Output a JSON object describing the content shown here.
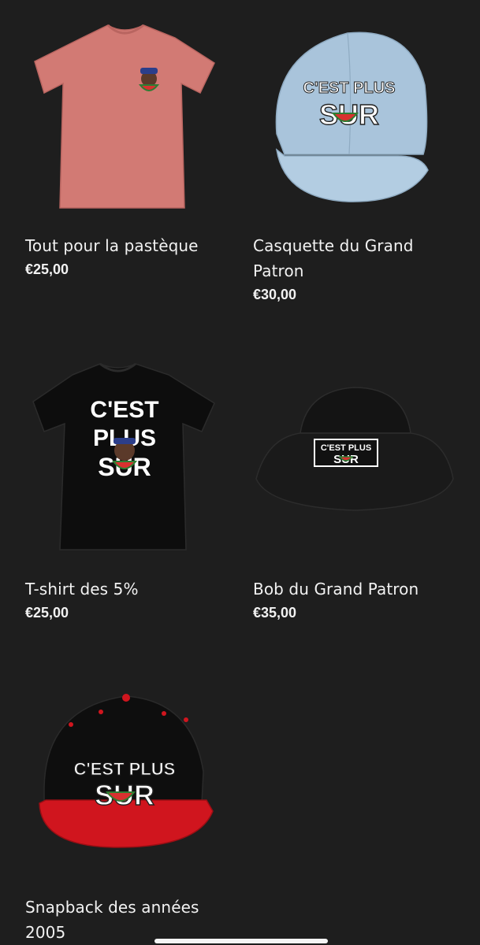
{
  "products": [
    {
      "name": "Tout pour la pastèque",
      "price": "€25,00",
      "image_icon": "pink-tshirt-watermelon-icon"
    },
    {
      "name": "Casquette du Grand Patron",
      "price": "€30,00",
      "image_icon": "light-blue-cap-icon",
      "logo_text": [
        "C'EST PLUS",
        "SUR"
      ]
    },
    {
      "name": "T-shirt des 5%",
      "price": "€25,00",
      "image_icon": "black-tshirt-logo-icon",
      "logo_text": [
        "C'EST",
        "PLUS",
        "SUR"
      ]
    },
    {
      "name": "Bob du Grand Patron",
      "price": "€35,00",
      "image_icon": "black-bucket-hat-icon",
      "logo_text": [
        "C'EST PLUS",
        "SUR"
      ]
    },
    {
      "name": "Snapback des années 2005",
      "image_icon": "black-red-snapback-icon",
      "logo_text": [
        "C'EST PLUS",
        "SUR"
      ]
    }
  ],
  "colors": {
    "background": "#1e1e1e",
    "text": "#f2f2f2",
    "watermelon_red": "#d8312f",
    "watermelon_green": "#2e7d32"
  }
}
